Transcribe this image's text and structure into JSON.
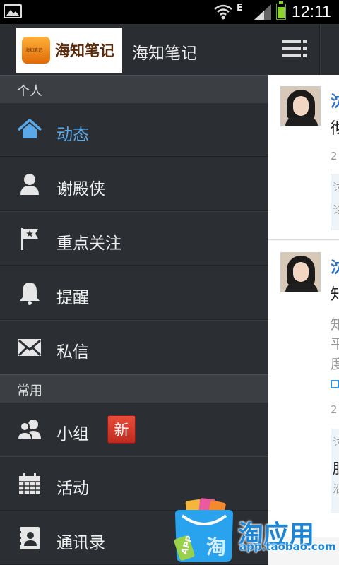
{
  "status_bar": {
    "network_type": "E",
    "time": "12:11"
  },
  "drawer": {
    "logo_text": "海知笔记",
    "logo_small": "海知笔记",
    "app_name": "海知笔记",
    "sections": [
      {
        "title": "个人",
        "items": [
          {
            "label": "动态",
            "icon": "home-icon",
            "active": true
          },
          {
            "label": "谢殿侠",
            "icon": "person-icon"
          },
          {
            "label": "重点关注",
            "icon": "flag-icon"
          },
          {
            "label": "提醒",
            "icon": "bell-icon"
          },
          {
            "label": "私信",
            "icon": "envelope-icon"
          }
        ]
      },
      {
        "title": "常用",
        "items": [
          {
            "label": "小组",
            "icon": "group-icon",
            "badge": "新"
          },
          {
            "label": "活动",
            "icon": "calendar-icon"
          },
          {
            "label": "通讯录",
            "icon": "contacts-icon"
          }
        ]
      }
    ]
  },
  "feed": {
    "cards": [
      {
        "name_char": "沈",
        "text_char": "彻",
        "meta_char": "2",
        "quote_chars": [
          "讨",
          "论"
        ]
      },
      {
        "name_char": "沈",
        "text_char": "知",
        "body_chars": [
          "知",
          "平",
          "度"
        ],
        "meta_char": "2",
        "quote_chars": [
          "讨",
          "胆",
          "沿"
        ]
      }
    ]
  },
  "watermark": {
    "text": "淘应用",
    "url": "app.taobao.com",
    "bag_label": "APP",
    "bag_char": "淘"
  },
  "colors": {
    "accent": "#5aa8e8",
    "badge": "#d43a2c",
    "drawer_bg": "#2b2f34",
    "watermark": "#1b85d8"
  }
}
